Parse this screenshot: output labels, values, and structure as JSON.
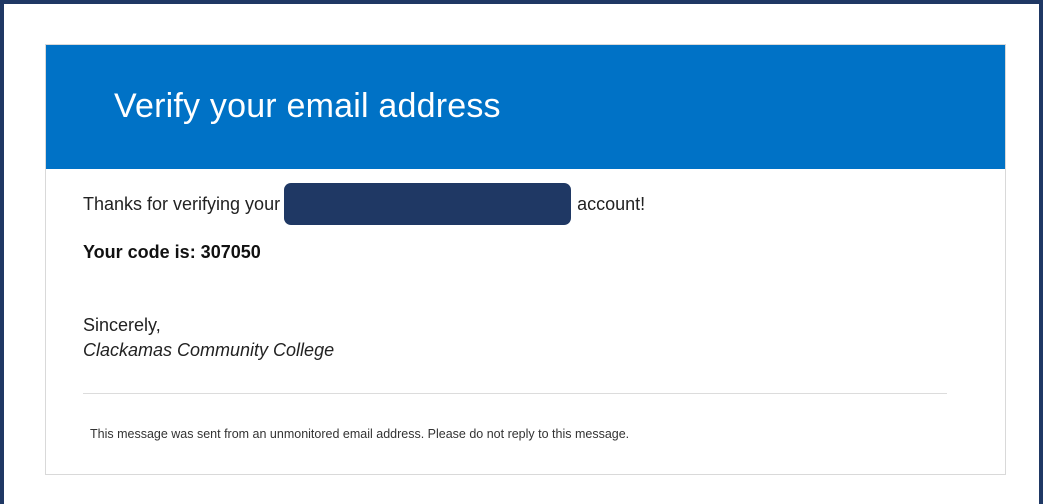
{
  "email": {
    "header_title": "Verify your email address",
    "thanks_prefix": "Thanks for verifying your",
    "thanks_suffix": "account!",
    "code_line": "Your code is: 307050",
    "sign_off": "Sincerely,",
    "organization": "Clackamas Community College",
    "footer_note": "This message was sent from an unmonitored email address. Please do not reply to this message."
  },
  "colors": {
    "header_blue": "#0072c6",
    "redaction_navy": "#1f3864",
    "frame_border": "#1f3864"
  }
}
